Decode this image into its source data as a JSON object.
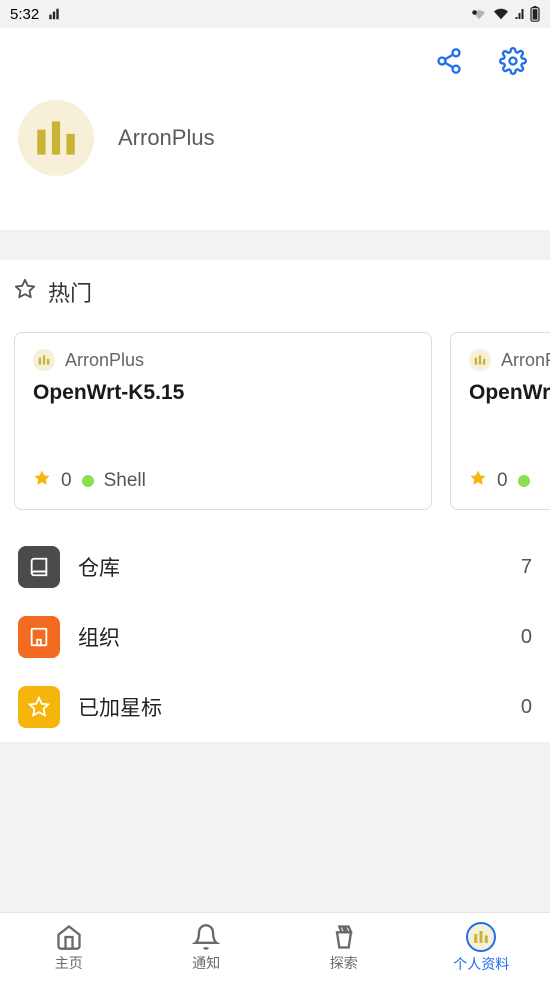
{
  "status": {
    "time": "5:32"
  },
  "profile": {
    "username": "ArronPlus"
  },
  "popular": {
    "title": "热门",
    "cards": [
      {
        "owner": "ArronPlus",
        "name": "OpenWrt-K5.15",
        "stars": "0",
        "language": "Shell",
        "lang_color": "#89e051"
      },
      {
        "owner": "ArronPlus",
        "name": "OpenWr",
        "stars": "0",
        "language": "",
        "lang_color": "#89e051"
      }
    ]
  },
  "lists": {
    "repos": {
      "label": "仓库",
      "count": "7",
      "color": "#4b4b4b"
    },
    "orgs": {
      "label": "组织",
      "count": "0",
      "color": "#f26b21"
    },
    "starred": {
      "label": "已加星标",
      "count": "0",
      "color": "#f5b50a"
    }
  },
  "nav": {
    "home": "主页",
    "notif": "通知",
    "explore": "探索",
    "profile": "个人资料"
  }
}
